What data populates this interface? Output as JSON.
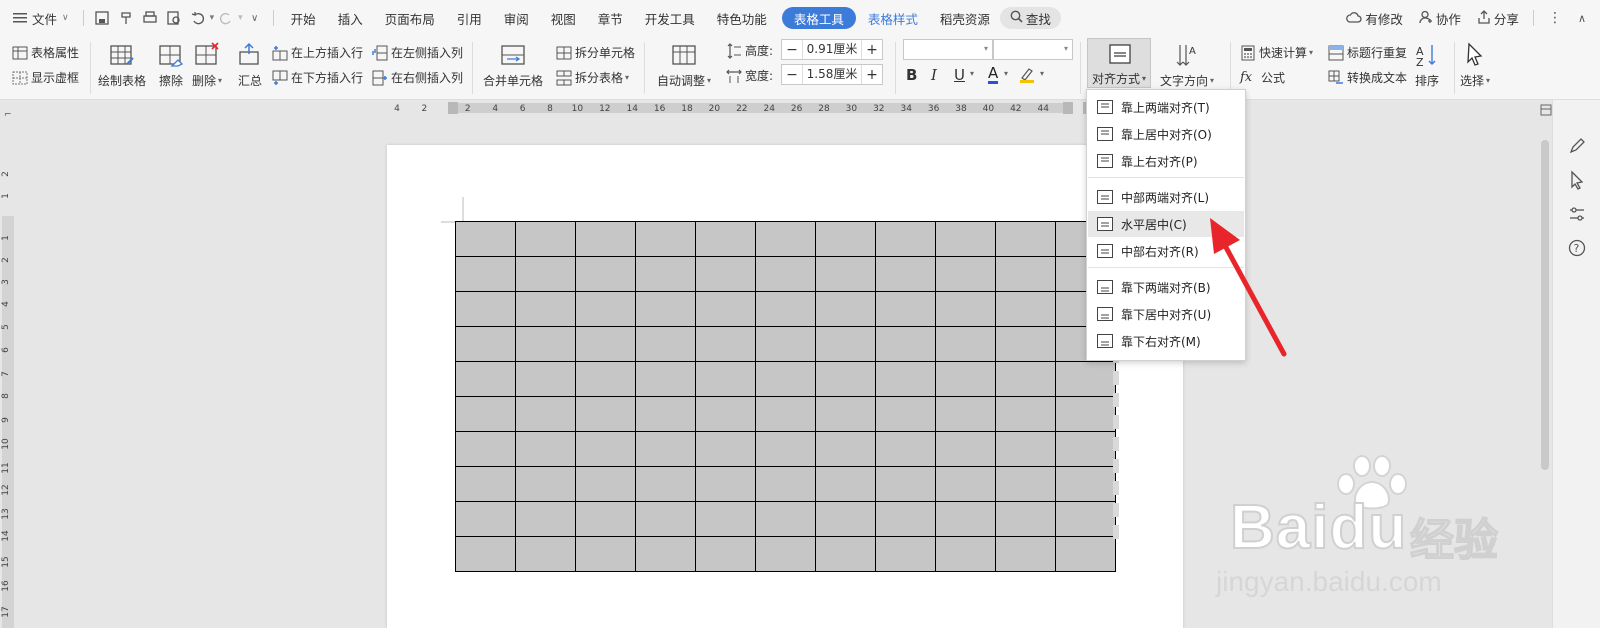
{
  "menubar": {
    "file": "文件",
    "tabs": [
      {
        "label": "开始"
      },
      {
        "label": "插入"
      },
      {
        "label": "页面布局"
      },
      {
        "label": "引用"
      },
      {
        "label": "审阅"
      },
      {
        "label": "视图"
      },
      {
        "label": "章节"
      },
      {
        "label": "开发工具"
      },
      {
        "label": "特色功能"
      },
      {
        "label": "表格工具"
      },
      {
        "label": "表格样式"
      },
      {
        "label": "稻壳资源"
      }
    ],
    "search": "查找",
    "has_changes": "有修改",
    "collaborate": "协作",
    "share": "分享"
  },
  "ribbon": {
    "table_props": "表格属性",
    "show_gridlines": "显示虚框",
    "draw_table": "绘制表格",
    "erase": "擦除",
    "delete": "删除",
    "summary": "汇总",
    "insert_row_above": "在上方插入行",
    "insert_row_below": "在下方插入行",
    "insert_col_left": "在左侧插入列",
    "insert_col_right": "在右侧插入列",
    "merge_cells": "合并单元格",
    "split_cells": "拆分单元格",
    "split_table": "拆分表格",
    "auto_fit": "自动调整",
    "height_label": "高度:",
    "height_value": "0.91厘米",
    "width_label": "宽度:",
    "width_value": "1.58厘米",
    "bold": "B",
    "italic": "I",
    "underline": "U",
    "font_color": "A",
    "alignment": "对齐方式",
    "text_direction": "文字方向",
    "quick_calc": "快速计算",
    "formula": "公式",
    "header_repeat": "标题行重复",
    "convert_to_text": "转换成文本",
    "sort": "排序",
    "select": "选择",
    "minus": "−",
    "plus": "+"
  },
  "ruler": {
    "h_ticks": [
      "4",
      "2",
      "2",
      "4",
      "6",
      "8",
      "10",
      "12",
      "14",
      "16",
      "18",
      "20",
      "22",
      "24",
      "26",
      "28",
      "30",
      "32",
      "34",
      "36",
      "38",
      "40",
      "42",
      "44"
    ],
    "v_ticks": [
      "2",
      "1",
      "1",
      "2",
      "3",
      "4",
      "5",
      "6",
      "7",
      "8",
      "9",
      "10",
      "11",
      "12",
      "13",
      "14",
      "15",
      "16",
      "17"
    ]
  },
  "table": {
    "rows": 10,
    "cols": 11
  },
  "dropdown": {
    "items": [
      {
        "label": "靠上两端对齐(T)"
      },
      {
        "label": "靠上居中对齐(O)"
      },
      {
        "label": "靠上右对齐(P)"
      },
      {
        "label": "中部两端对齐(L)"
      },
      {
        "label": "水平居中(C)"
      },
      {
        "label": "中部右对齐(R)"
      },
      {
        "label": "靠下两端对齐(B)"
      },
      {
        "label": "靠下居中对齐(U)"
      },
      {
        "label": "靠下右对齐(M)"
      }
    ]
  },
  "watermark": {
    "brand": "Baidu",
    "cn": "经验",
    "url": "jingyan.baidu.com"
  },
  "colors": {
    "accent": "#3d7bd9",
    "arrow": "#e8252a",
    "cell": "#c6c6c6"
  }
}
